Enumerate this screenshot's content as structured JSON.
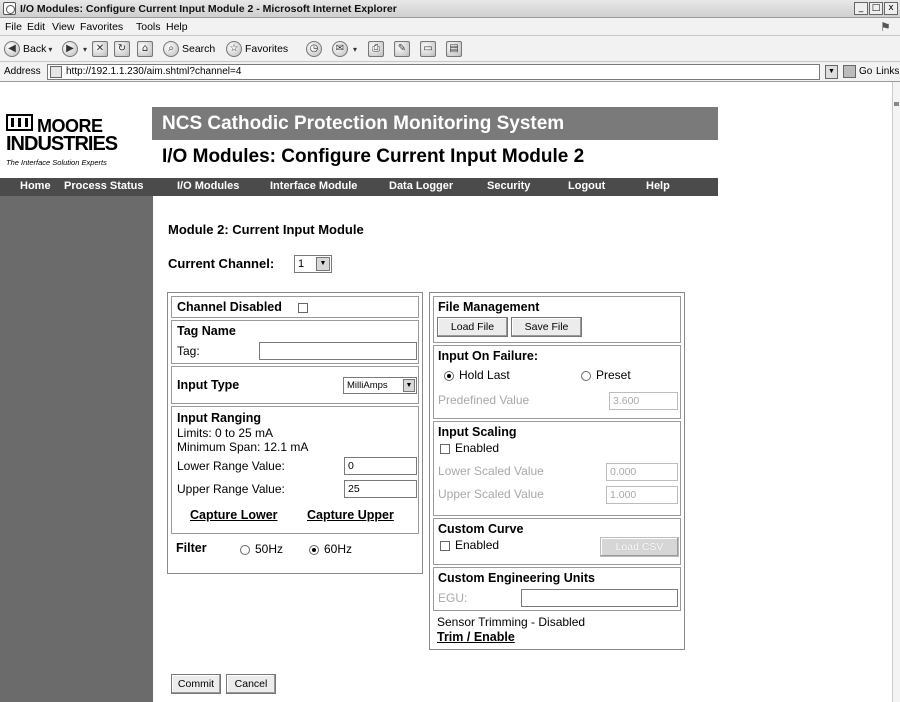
{
  "window": {
    "title": "I/O Modules: Configure Current Input Module 2 - Microsoft Internet Explorer",
    "buttons": [
      "_",
      "□",
      "x"
    ]
  },
  "menu": [
    "File",
    "Edit",
    "View",
    "Favorites",
    "Tools",
    "Help"
  ],
  "toolbar": {
    "back": "Back",
    "search": "Search",
    "favorites": "Favorites"
  },
  "address": {
    "label": "Address",
    "url": "http://192.1.1.230/aim.shtml?channel=4",
    "go": "Go",
    "links": "Links"
  },
  "brand": {
    "line1": "MOORE",
    "line2": "INDUSTRIES",
    "tagline": "The Interface Solution Experts"
  },
  "header": {
    "system": "NCS Cathodic Protection Monitoring System",
    "page_title": "I/O Modules: Configure Current Input Module 2"
  },
  "nav": [
    "Home",
    "Process Status",
    "I/O Modules",
    "Interface Module",
    "Data Logger",
    "Security",
    "Logout",
    "Help"
  ],
  "module": {
    "title": "Module 2: Current Input Module",
    "channel_label": "Current Channel:",
    "channel_value": "1"
  },
  "left": {
    "channel_disabled": "Channel Disabled",
    "tag_name": "Tag Name",
    "tag_label": "Tag:",
    "tag_value": "",
    "input_type_label": "Input Type",
    "input_type_value": "MilliAmps",
    "input_ranging": "Input Ranging",
    "limits": "Limits: 0 to 25 mA",
    "min_span": "Minimum Span: 12.1 mA",
    "lower_label": "Lower Range Value:",
    "lower_value": "0",
    "upper_label": "Upper Range Value:",
    "upper_value": "25",
    "capture_lower": "Capture Lower",
    "capture_upper": "Capture Upper",
    "filter_label": "Filter",
    "filter_50": "50Hz",
    "filter_60": "60Hz",
    "filter_selected": "60Hz"
  },
  "right": {
    "file_mgmt": "File Management",
    "load_file": "Load File",
    "save_file": "Save File",
    "on_failure": "Input On Failure:",
    "hold_last": "Hold Last",
    "preset": "Preset",
    "failure_selected": "Hold Last",
    "predefined_label": "Predefined Value",
    "predefined_value": "3.600",
    "scaling": "Input Scaling",
    "scaling_enabled": "Enabled",
    "lower_scaled_label": "Lower Scaled Value",
    "lower_scaled_value": "0.000",
    "upper_scaled_label": "Upper Scaled Value",
    "upper_scaled_value": "1.000",
    "custom_curve": "Custom Curve",
    "curve_enabled": "Enabled",
    "load_csv": "Load CSV",
    "ceu": "Custom Engineering Units",
    "egu_label": "EGU:",
    "egu_value": "",
    "sensor_trimming": "Sensor Trimming - Disabled",
    "trim_enable": "Trim / Enable"
  },
  "actions": {
    "commit": "Commit",
    "cancel": "Cancel"
  }
}
